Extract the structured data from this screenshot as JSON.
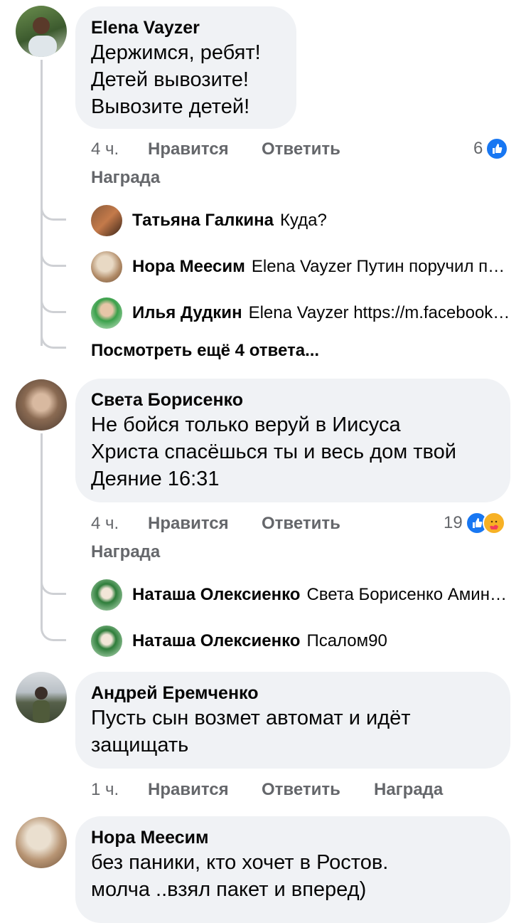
{
  "actions": {
    "like": "Нравится",
    "reply": "Ответить",
    "award": "Награда"
  },
  "comments": [
    {
      "author": "Elena Vayzer",
      "text": "Держимся, ребят!\nДетей вывозите!\nВывозите детей!",
      "time": "4 ч.",
      "reactions": "6",
      "replies": [
        {
          "author": "Татьяна Галкина",
          "text": "Куда?"
        },
        {
          "author": "Нора Меесим",
          "text": "Elena Vayzer Путин поручил проверить, кто это все..."
        },
        {
          "author": "Илья Дудкин",
          "text": "Elena Vayzer https://m.facebook.com/story.php"
        }
      ],
      "more_replies": "Посмотреть ещё 4 ответа..."
    },
    {
      "author": "Света Борисенко",
      "text": "Не бойся только веруй в Иисуса\nХриста спасёшься ты и весь дом твой\nДеяние 16:31",
      "time": "4 ч.",
      "reactions": "19",
      "replies": [
        {
          "author": "Наташа Олексиенко",
          "text": "Света Борисенко Аминь и слава Богу"
        },
        {
          "author": "Наташа Олексиенко",
          "text": "Псалом90"
        }
      ]
    },
    {
      "author": "Андрей Еремченко",
      "text": "Пусть сын возмет автомат и идёт\nзащищать",
      "time": "1 ч."
    },
    {
      "author": "Нора Меесим",
      "text": "без паники, кто хочет в Ростов.\nмолча ..взял пакет и вперед)"
    }
  ],
  "colors": {
    "bubble": "#f0f2f5",
    "meta": "#65676b",
    "like_blue": "#1877f2",
    "thread": "#ced0d4"
  }
}
